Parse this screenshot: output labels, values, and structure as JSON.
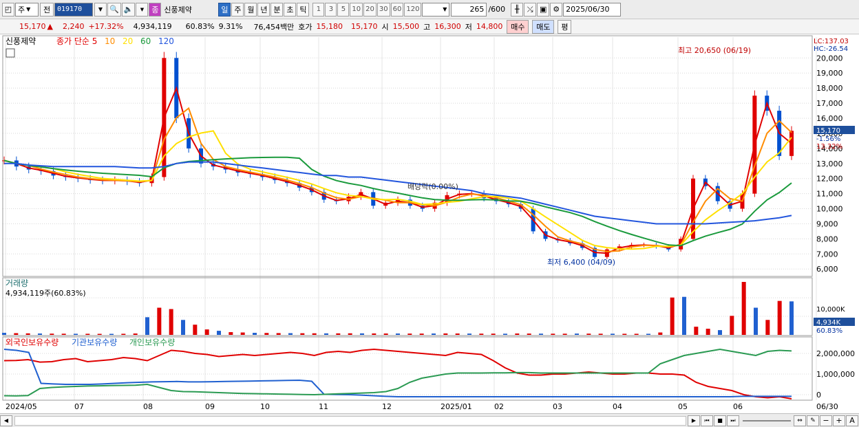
{
  "toolbar": {
    "period_type": "주",
    "prev_label": "전",
    "stock_code": "019170",
    "stock_badge": "종",
    "stock_name": "신풍제약",
    "periods": [
      "일",
      "주",
      "월",
      "년",
      "분",
      "초",
      "틱"
    ],
    "selected_period": "일",
    "intervals": [
      "1",
      "3",
      "5",
      "10",
      "20",
      "30",
      "60",
      "120"
    ],
    "count": "265",
    "count_total": "/600",
    "date": "2025/06/30"
  },
  "quote": {
    "price": "15,170",
    "change": "2,240",
    "change_pct": "+17.32%",
    "volume": "4,934,119",
    "volume_ratio": "60.83%",
    "turnover": "9.31%",
    "amount": "76,454백만",
    "ask_label": "호가",
    "ask": "15,180",
    "bid": "15,170",
    "open_label": "시",
    "open": "15,500",
    "high_label": "고",
    "high": "16,300",
    "low_label": "저",
    "low": "14,800",
    "buy_label": "매수",
    "sell_label": "매도",
    "eval_label": "평"
  },
  "chart_data": [
    {
      "type": "candlestick",
      "title": "신풍제약",
      "legend": [
        "종가 단순 5",
        "10",
        "20",
        "60",
        "120"
      ],
      "colors": {
        "up": "#e00000",
        "down": "#0050d0",
        "ma5": "#e00000",
        "ma10": "#ff8c00",
        "ma20": "#ffe000",
        "ma60": "#1a9a3c",
        "ma120": "#2255dd"
      },
      "x_ticks": [
        "2024/05",
        "07",
        "08",
        "09",
        "10",
        "11",
        "12",
        "2025/01",
        "02",
        "03",
        "04",
        "05",
        "06",
        "06/30"
      ],
      "y_ticks": [
        6000,
        7000,
        8000,
        9000,
        10000,
        11000,
        12000,
        13000,
        14000,
        15000,
        16000,
        17000,
        18000,
        19000,
        20000
      ],
      "ylim": [
        5600,
        21200
      ],
      "annotations": {
        "high": "최고 20,650 (06/19)",
        "low": "최저 6,400 (04/09)",
        "dividend": "배당락(0.00%)",
        "lc": "LC:137.03",
        "hc": "HC:-26.54",
        "last_price": "15,170",
        "last_change": "-1.56%",
        "last_change2": "13.32%"
      },
      "close": [
        13200,
        12800,
        12600,
        12500,
        12200,
        12100,
        12000,
        11900,
        11850,
        11900,
        11800,
        11700,
        12100,
        20000,
        16000,
        14000,
        13000,
        12800,
        12600,
        12400,
        12300,
        12100,
        11900,
        11700,
        11400,
        11100,
        10600,
        10500,
        10800,
        11100,
        10200,
        10400,
        10600,
        10200,
        10000,
        10400,
        10900,
        11000,
        11000,
        10700,
        10500,
        10300,
        10000,
        8500,
        8000,
        7900,
        7700,
        7400,
        6800,
        7300,
        7500,
        7600,
        7600,
        7500,
        7300,
        8000,
        12000,
        11500,
        10500,
        10000,
        11000,
        17500,
        16500,
        13500,
        15170
      ],
      "ma120": [
        13000,
        13000,
        12900,
        12850,
        12800,
        12800,
        12800,
        12800,
        12800,
        12800,
        12750,
        12700,
        12700,
        12800,
        13000,
        13100,
        13100,
        13100,
        13000,
        12900,
        12800,
        12700,
        12600,
        12500,
        12400,
        12300,
        12200,
        12200,
        12100,
        12100,
        12000,
        11900,
        11800,
        11700,
        11600,
        11500,
        11400,
        11300,
        11200,
        11000,
        10900,
        10800,
        10700,
        10500,
        10300,
        10100,
        9900,
        9700,
        9500,
        9400,
        9300,
        9200,
        9100,
        9000,
        9000,
        9000,
        9000,
        9000,
        9050,
        9100,
        9150,
        9200,
        9300,
        9400,
        9550
      ]
    },
    {
      "type": "bar",
      "title": "거래량",
      "value_label": "4,934,119주(60.83%)",
      "y_tick": "10,000K",
      "last_label": "4,934K",
      "last_ratio": "60.83%",
      "values": [
        300,
        250,
        220,
        200,
        180,
        170,
        160,
        160,
        150,
        150,
        160,
        200,
        2600,
        4000,
        3800,
        2200,
        1500,
        800,
        600,
        400,
        350,
        300,
        280,
        260,
        250,
        240,
        230,
        220,
        220,
        230,
        220,
        210,
        200,
        200,
        190,
        190,
        200,
        210,
        200,
        190,
        180,
        180,
        170,
        200,
        190,
        180,
        170,
        170,
        190,
        180,
        170,
        170,
        160,
        160,
        160,
        350,
        5500,
        5600,
        1200,
        900,
        700,
        2800,
        7800,
        4000,
        2200,
        5000,
        4934
      ]
    },
    {
      "type": "line",
      "legend": [
        "외국인보유수량",
        "기관보유수량",
        "개인보유수량"
      ],
      "y_ticks": [
        "2,000,000",
        "1,000,000",
        "0"
      ],
      "ylim": [
        -200000,
        2400000
      ],
      "series": [
        {
          "name": "외국인보유수량",
          "color": "#e00000",
          "values": [
            1650,
            1660,
            1700,
            1580,
            1600,
            1700,
            1750,
            1600,
            1650,
            1700,
            1800,
            1750,
            1650,
            1900,
            2150,
            2100,
            2000,
            1950,
            1850,
            1900,
            1950,
            1900,
            1950,
            2000,
            2050,
            2000,
            1900,
            2050,
            2100,
            2050,
            2150,
            2200,
            2150,
            2100,
            2050,
            2000,
            1950,
            1900,
            2050,
            2000,
            1950,
            1650,
            1300,
            1050,
            950,
            950,
            1000,
            1000,
            1050,
            1100,
            1050,
            1000,
            1000,
            1050,
            1050,
            1000,
            1000,
            950,
            600,
            400,
            300,
            200,
            0,
            -100,
            -150,
            -100,
            -200
          ]
        },
        {
          "name": "기관보유수량",
          "color": "#2060d0",
          "values": [
            2200,
            2150,
            2050,
            550,
            520,
            500,
            500,
            500,
            520,
            550,
            580,
            600,
            620,
            630,
            640,
            620,
            620,
            630,
            640,
            650,
            660,
            670,
            680,
            690,
            700,
            650,
            20,
            10,
            0,
            -20,
            -50,
            -80,
            -100,
            -100,
            -100,
            -100,
            -100,
            -100,
            -100,
            -100,
            -100,
            -100,
            -100,
            -100,
            -100,
            -100,
            -100,
            -100,
            -100,
            -100,
            -100,
            -100,
            -100,
            -100,
            -100,
            -100,
            -100,
            -100,
            -100,
            -100,
            -80,
            -80,
            -80,
            -80,
            -80
          ]
        },
        {
          "name": "개인보유수량",
          "color": "#2a9a52",
          "values": [
            -50,
            -60,
            -40,
            300,
            350,
            380,
            400,
            420,
            430,
            440,
            450,
            460,
            500,
            350,
            200,
            150,
            140,
            120,
            100,
            80,
            60,
            50,
            40,
            30,
            20,
            10,
            0,
            20,
            40,
            60,
            80,
            100,
            150,
            300,
            600,
            800,
            900,
            1000,
            1050,
            1050,
            1050,
            1060,
            1060,
            1070,
            1070,
            1050,
            1050,
            1050,
            1050,
            1050,
            1050,
            1050,
            1050,
            1050,
            1050,
            1500,
            1700,
            1900,
            2000,
            2100,
            2200,
            2100,
            2000,
            1900,
            2100,
            2150,
            2120
          ]
        }
      ]
    }
  ],
  "statusbar": {
    "zoom_label": "A"
  }
}
